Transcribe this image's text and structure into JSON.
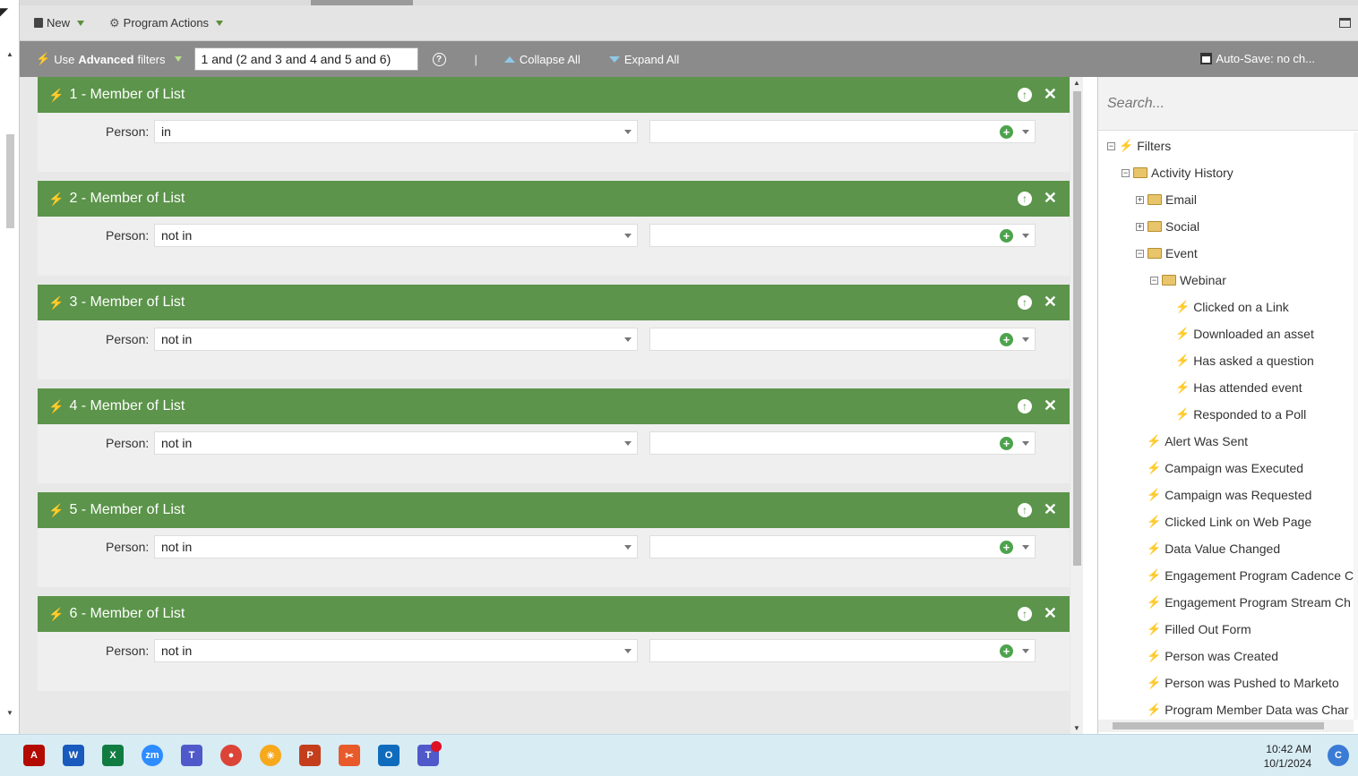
{
  "toolbar": {
    "new_label": "New",
    "program_actions_label": "Program Actions"
  },
  "filterbar": {
    "use_label": "Use",
    "advanced_label": "Advanced",
    "filters_label": "filters",
    "logic_value": "1 and (2 and 3 and 4 and 5 and 6)",
    "help_glyph": "?",
    "separator": "|",
    "collapse_label": "Collapse All",
    "expand_label": "Expand All",
    "autosave_label": "Auto-Save: no ch..."
  },
  "filters": [
    {
      "title": "1 - Member of List",
      "person_label": "Person:",
      "operator": "in"
    },
    {
      "title": "2 - Member of List",
      "person_label": "Person:",
      "operator": "not in"
    },
    {
      "title": "3 - Member of List",
      "person_label": "Person:",
      "operator": "not in"
    },
    {
      "title": "4 - Member of List",
      "person_label": "Person:",
      "operator": "not in"
    },
    {
      "title": "5 - Member of List",
      "person_label": "Person:",
      "operator": "not in"
    },
    {
      "title": "6 - Member of List",
      "person_label": "Person:",
      "operator": "not in"
    }
  ],
  "sidebar": {
    "search_placeholder": "Search...",
    "tree": [
      {
        "label": "Filters",
        "toggle": "⊟",
        "kind": "root"
      },
      {
        "label": "Activity History",
        "toggle": "⊟",
        "kind": "folder"
      },
      {
        "label": "Email",
        "toggle": "⊞",
        "kind": "folder"
      },
      {
        "label": "Social",
        "toggle": "⊞",
        "kind": "folder"
      },
      {
        "label": "Event",
        "toggle": "⊟",
        "kind": "folder"
      },
      {
        "label": "Webinar",
        "toggle": "⊟",
        "kind": "folder"
      },
      {
        "label": "Clicked on a Link",
        "kind": "filter"
      },
      {
        "label": "Downloaded an asset",
        "kind": "filter"
      },
      {
        "label": "Has asked a question",
        "kind": "filter"
      },
      {
        "label": "Has attended event",
        "kind": "filter"
      },
      {
        "label": "Responded to a Poll",
        "kind": "filter"
      },
      {
        "label": "Alert Was Sent",
        "kind": "filter"
      },
      {
        "label": "Campaign was Executed",
        "kind": "filter"
      },
      {
        "label": "Campaign was Requested",
        "kind": "filter"
      },
      {
        "label": "Clicked Link on Web Page",
        "kind": "filter"
      },
      {
        "label": "Data Value Changed",
        "kind": "filter"
      },
      {
        "label": "Engagement Program Cadence C",
        "kind": "filter"
      },
      {
        "label": "Engagement Program Stream Ch",
        "kind": "filter"
      },
      {
        "label": "Filled Out Form",
        "kind": "filter"
      },
      {
        "label": "Person was Created",
        "kind": "filter"
      },
      {
        "label": "Person was Pushed to Marketo",
        "kind": "filter"
      },
      {
        "label": "Program Member Data was Char",
        "kind": "filter"
      }
    ]
  },
  "taskbar": {
    "time": "10:42 AM",
    "date": "10/1/2024"
  },
  "colors": {
    "filter_header": "#5b944a",
    "filterbar": "#8b8b8b",
    "taskbar": "#d8ecf4"
  }
}
